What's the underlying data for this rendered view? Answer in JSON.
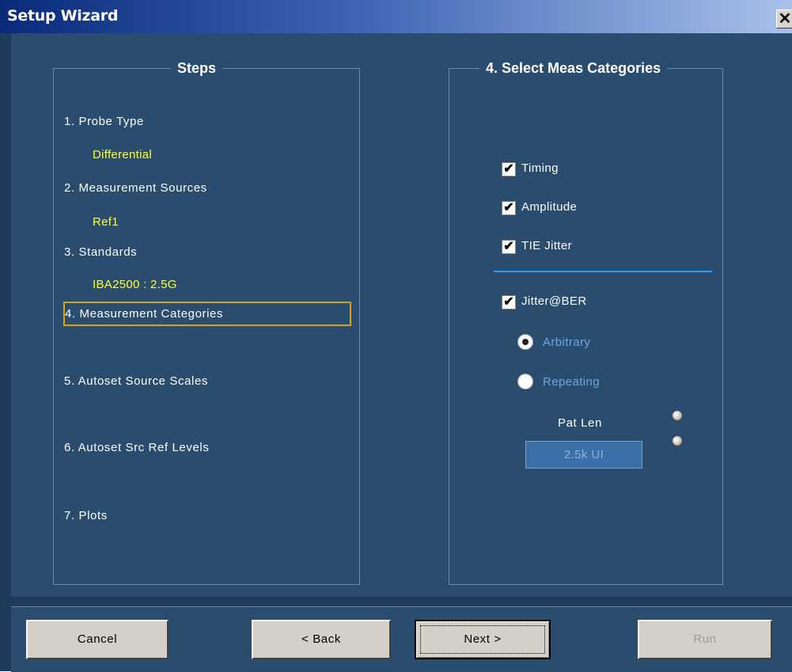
{
  "window": {
    "title": "Setup Wizard",
    "close_glyph": "✕"
  },
  "steps": {
    "legend": "Steps",
    "items": [
      {
        "label": "1. Probe Type",
        "value": "Differential"
      },
      {
        "label": "2. Measurement Sources",
        "value": "Ref1"
      },
      {
        "label": "3. Standards",
        "value": "IBA2500 : 2.5G"
      },
      {
        "label": "4. Measurement Categories"
      },
      {
        "label": "5. Autoset Source Scales"
      },
      {
        "label": "6. Autoset Src Ref Levels"
      },
      {
        "label": "7. Plots"
      }
    ],
    "active_index": 3
  },
  "categories": {
    "legend": "4. Select Meas Categories",
    "checkboxes": [
      {
        "label": "Timing",
        "checked": true
      },
      {
        "label": "Amplitude",
        "checked": true
      },
      {
        "label": "TIE Jitter",
        "checked": true
      },
      {
        "label": "Jitter@BER",
        "checked": true
      }
    ],
    "check_glyph": "✔",
    "pattern": {
      "options": [
        {
          "label": "Arbitrary",
          "selected": true
        },
        {
          "label": "Repeating",
          "selected": false
        }
      ],
      "pat_len_label": "Pat Len",
      "pat_len_value": "2.5k UI"
    }
  },
  "buttons": {
    "cancel": "Cancel",
    "back": "< Back",
    "next": "Next >",
    "run": "Run"
  },
  "colors": {
    "background": "#2a4c6e",
    "step_value": "#ffff33",
    "radio_label": "#6fa6e6",
    "active_step_border": "#d9a21b",
    "separator": "#3399ee"
  }
}
